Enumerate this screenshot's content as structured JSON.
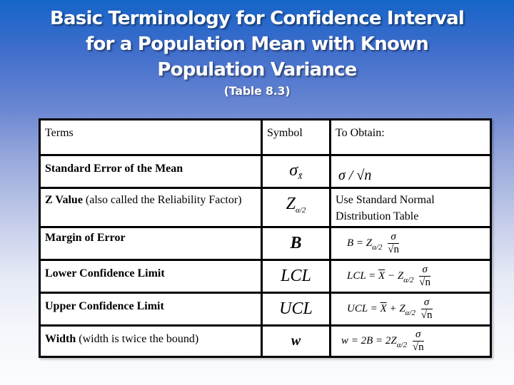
{
  "slide": {
    "title_line1": "Basic Terminology for Confidence Interval",
    "title_line2": "for a Population Mean with Known",
    "title_line3": "Population Variance",
    "subtitle": "(Table 8.3)"
  },
  "colors": {
    "background_top": "#1565c8",
    "background_bottom": "#fbfcfe",
    "title_text": "#ffffff",
    "table_border": "#000000",
    "table_background": "#ffffff"
  },
  "table": {
    "headers": {
      "terms": "Terms",
      "symbol": "Symbol",
      "to_obtain": "To Obtain:"
    },
    "rows": [
      {
        "term_bold": "Standard Error of the Mean",
        "term_rest": "",
        "symbol": "σ",
        "symbol_sub": "X̄",
        "obtain_text": "σ / √n"
      },
      {
        "term_bold": "Z Value",
        "term_rest": " (also called the Reliability Factor)",
        "symbol": "Z",
        "symbol_sub": "α/2",
        "obtain_text": "Use Standard Normal Distribution Table"
      },
      {
        "term_bold": "Margin of Error",
        "term_rest": "",
        "symbol": "B",
        "symbol_sub": "",
        "obtain_lhs": "B = Z",
        "obtain_sub": "α/2",
        "obtain_num": "σ",
        "obtain_den": "√n"
      },
      {
        "term_bold": "Lower Confidence Limit",
        "term_rest": "",
        "symbol": "LCL",
        "symbol_sub": "",
        "obtain_lhs_a": "LCL = ",
        "obtain_xbar": "X",
        "obtain_lhs_b": " − Z",
        "obtain_sub": "α/2",
        "obtain_num": "σ",
        "obtain_den": "√n"
      },
      {
        "term_bold": "Upper Confidence Limit",
        "term_rest": "",
        "symbol": "UCL",
        "symbol_sub": "",
        "obtain_lhs_a": "UCL = ",
        "obtain_xbar": "X",
        "obtain_lhs_b": " + Z",
        "obtain_sub": "α/2",
        "obtain_num": "σ",
        "obtain_den": "√n"
      },
      {
        "term_bold": "Width",
        "term_rest": " (width is twice the bound)",
        "symbol": "w",
        "symbol_sub": "",
        "obtain_lhs": "w = 2B = 2Z",
        "obtain_sub": "α/2",
        "obtain_num": "σ",
        "obtain_den": "√n"
      }
    ]
  }
}
